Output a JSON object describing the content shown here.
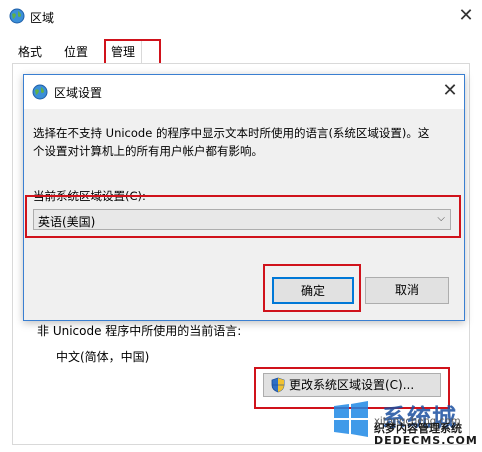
{
  "window": {
    "title": "区域"
  },
  "tabs": [
    {
      "label": "格式"
    },
    {
      "label": "位置"
    },
    {
      "label": "管理"
    }
  ],
  "dialog": {
    "title": "区域设置",
    "description_line1": "选择在不支持 Unicode 的程序中显示文本时所使用的语言(系统区域设置)。这",
    "description_line2": "个设置对计算机上的所有用户帐户都有影响。",
    "current_label": "当前系统区域设置(C):",
    "current_value": "英语(美国)",
    "ok_label": "确定",
    "cancel_label": "取消"
  },
  "admin": {
    "non_unicode_label": "非 Unicode 程序中所使用的当前语言:",
    "current_language": "中文(简体，中国)",
    "change_button_label": "更改系统区域设置(C)..."
  },
  "watermark": {
    "brand": "系统城",
    "site": "xitongcheng.com",
    "cms": "织梦内容管理系统",
    "cms_site": "DEDECMS.COM"
  },
  "colors": {
    "highlight": "#d0121b",
    "accent": "#0078d7",
    "watermark": "#1b4fa0"
  }
}
